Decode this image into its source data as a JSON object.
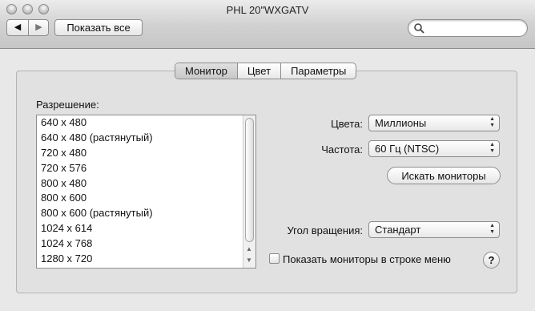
{
  "window": {
    "title": "PHL 20\"WXGATV"
  },
  "toolbar": {
    "back_icon": "◀",
    "forward_icon": "▶",
    "show_all_label": "Показать все",
    "search_value": ""
  },
  "tabs": [
    {
      "label": "Монитор",
      "selected": true
    },
    {
      "label": "Цвет",
      "selected": false
    },
    {
      "label": "Параметры",
      "selected": false
    }
  ],
  "resolution": {
    "label": "Разрешение:",
    "items": [
      "640 x 480",
      "640 x 480 (растянутый)",
      "720 x 480",
      "720 x 576",
      "800 x 480",
      "800 x 600",
      "800 x 600 (растянутый)",
      "1024 x 614",
      "1024 x 768",
      "1280 x 720"
    ]
  },
  "settings": {
    "colors_label": "Цвета:",
    "colors_value": "Миллионы",
    "refresh_label": "Частота:",
    "refresh_value": "60 Гц (NTSC)",
    "detect_button": "Искать мониторы",
    "rotation_label": "Угол вращения:",
    "rotation_value": "Стандарт",
    "show_in_menubar_label": "Показать мониторы в строке меню",
    "show_in_menubar_checked": false,
    "help_glyph": "?"
  }
}
